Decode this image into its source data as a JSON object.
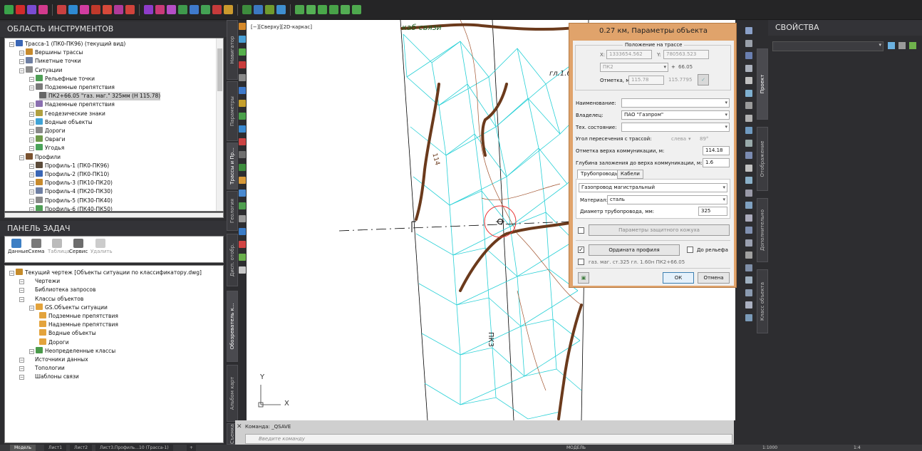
{
  "tools_panel": {
    "title": "ОБЛАСТЬ ИНСТРУМЕНТОВ",
    "tree": [
      {
        "label": "Трасса-1 (ПК0-ПК96) (текущий вид)",
        "level": 0
      },
      {
        "label": "Вершины трассы",
        "level": 1
      },
      {
        "label": "Пикетные точки",
        "level": 1
      },
      {
        "label": "Ситуации",
        "level": 1
      },
      {
        "label": "Рельефные точки",
        "level": 2
      },
      {
        "label": "Подземные препятствия",
        "level": 2
      },
      {
        "label": "ПК2+66.05 \"газ. маг.\" 325мм (Н 115.78)",
        "level": 3,
        "selected": true
      },
      {
        "label": "Надземные препятствия",
        "level": 2
      },
      {
        "label": "Геодезические знаки",
        "level": 2
      },
      {
        "label": "Водные объекты",
        "level": 2
      },
      {
        "label": "Дороги",
        "level": 2
      },
      {
        "label": "Овраги",
        "level": 2
      },
      {
        "label": "Угодья",
        "level": 2
      },
      {
        "label": "Профили",
        "level": 1
      },
      {
        "label": "Профиль-1 (ПК0-ПК96)",
        "level": 2
      },
      {
        "label": "Профиль-2 (ПК0-ПК10)",
        "level": 2
      },
      {
        "label": "Профиль-3 (ПК10-ПК20)",
        "level": 2
      },
      {
        "label": "Профиль-4 (ПК20-ПК30)",
        "level": 2
      },
      {
        "label": "Профиль-5 (ПК30-ПК40)",
        "level": 2
      },
      {
        "label": "Профиль-6 (ПК40-ПК50)",
        "level": 2
      }
    ]
  },
  "task_panel": {
    "title": "ПАНЕЛЬ ЗАДАЧ",
    "toolbar": [
      "Данные",
      "Схема",
      "Таблица",
      "Сервис",
      "Удалить"
    ],
    "tree": [
      {
        "label": "Текущий чертеж [Объекты ситуации по классификатору.dwg]",
        "level": 0
      },
      {
        "label": "Чертежи",
        "level": 1
      },
      {
        "label": "Библиотека запросов",
        "level": 1
      },
      {
        "label": "Классы объектов",
        "level": 1
      },
      {
        "label": "GS.Объекты ситуации",
        "level": 2
      },
      {
        "label": "Подземные препятствия",
        "level": 3
      },
      {
        "label": "Надземные препятствия",
        "level": 3
      },
      {
        "label": "Водные объекты",
        "level": 3
      },
      {
        "label": "Дороги",
        "level": 3
      },
      {
        "label": "Неопределенные классы",
        "level": 2
      },
      {
        "label": "Источники данных",
        "level": 1
      },
      {
        "label": "Топологии",
        "level": 1
      },
      {
        "label": "Шаблоны связи",
        "level": 1
      }
    ]
  },
  "left_vtabs": [
    "Навигатор",
    "Параметры",
    "Трассы и Пр...",
    "Геология",
    "Обозреватель к...",
    "Дисп. отобр.",
    "Альбом карт",
    "Съемка"
  ],
  "viewport": {
    "label": "[−][Сверху][2D-каркас]",
    "drawing_texts": [
      "каб связи",
      "гл.1.6",
      "114",
      "ПК3"
    ],
    "ucs_x": "X",
    "ucs_y": "Y"
  },
  "dialog": {
    "title": "0.27 км, Параметры объекта",
    "position_group": "Положение на трассе",
    "x_label": "X:",
    "x_value": "1333654.562",
    "y_label": "Y:",
    "y_value": "780563.523",
    "pk_value": "ПК2",
    "plus": "+",
    "pk_offset": "66.05",
    "elev_label": "Отметка, м:",
    "elev_value1": "115.78",
    "elev_value2": "115.7795",
    "name_label": "Наименование:",
    "name_value": "",
    "owner_label": "Владелец:",
    "owner_value": "ПАО \"Газпром\"",
    "tech_label": "Тех. состояние:",
    "tech_value": "",
    "angle_label": "Угол пересечения с трассой:",
    "angle_side": "слева",
    "angle_value": "89°",
    "top_label": "Отметка верха коммуникации, м:",
    "top_value": "114.18",
    "depth_label": "Глубина заложения до верха коммуникации, м:",
    "depth_value": "1.6",
    "tabs": [
      "Трубопроводы",
      "Кабели"
    ],
    "pipe_type": "Газопровод магистральный",
    "material_label": "Материал:",
    "material_value": "сталь",
    "diameter_label": "Диаметр трубопровода, мм:",
    "diameter_value": "325",
    "casing_button": "Параметры защитного кожуха",
    "ordinate_button": "Ордината профиля",
    "to_relief_label": "До рельефа",
    "ordinate_text": "газ. маг. ст.325 гл. 1.60н ПК2+66.05",
    "ok": "ОК",
    "cancel": "Отмена"
  },
  "command_line": {
    "history": "Команда: _QSAVE",
    "prompt": "Введите команду"
  },
  "status_bar": {
    "tabs": [
      "Модель",
      "Лист1",
      "Лист2",
      "Лист3.Профиль...10 (Трасса-1)"
    ],
    "model_label": "МОДЕЛЬ",
    "scale": "1:1000",
    "annot_scale": "1:4"
  },
  "properties_panel": {
    "title": "СВОЙСТВА"
  },
  "right_vtabs": [
    "Проект",
    "Отображение",
    "Дополнительно",
    "Класс объекта"
  ]
}
